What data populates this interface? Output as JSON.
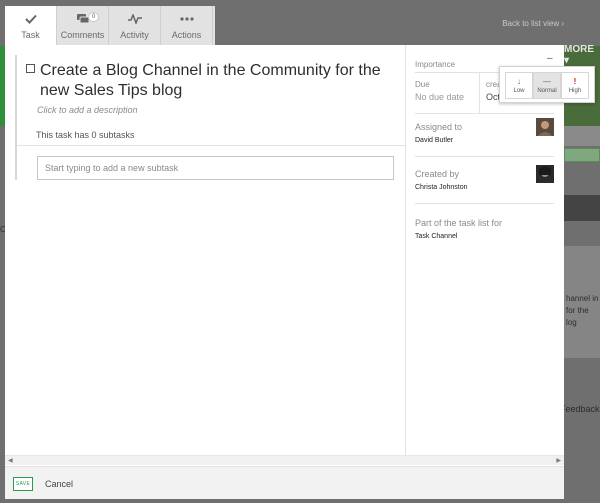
{
  "background": {
    "back_link": "Back to list view ›",
    "more_label": "MORE ▾",
    "side_text_lines": [
      "hannel in",
      "for the",
      "log"
    ],
    "feedback": "Feedback",
    "left_text": "Co"
  },
  "tabs": [
    {
      "label": "Task",
      "icon": "check-icon",
      "active": true
    },
    {
      "label": "Comments",
      "icon": "comments-icon",
      "badge": "0"
    },
    {
      "label": "Activity",
      "icon": "activity-icon"
    },
    {
      "label": "Actions",
      "icon": "more-icon"
    }
  ],
  "task": {
    "title": "Create a Blog Channel in the Community for the new Sales Tips blog",
    "description_placeholder": "Click to add a description",
    "subtasks_count_text": "This task has 0 subtasks",
    "new_subtask_placeholder": "Start typing to add a new subtask"
  },
  "sidebar": {
    "importance_label": "Importance",
    "importance_value": "–",
    "due_label": "Due",
    "due_value": "No due date",
    "created_label": "crea",
    "created_value": "Oct",
    "assigned_label": "Assigned to",
    "assigned_name": "David Butler",
    "created_by_label": "Created by",
    "created_by_name": "Christa Johnston",
    "task_list_label": "Part of the task list for",
    "task_list_name": "Task Channel"
  },
  "importance_popover": {
    "options": [
      {
        "label": "Low",
        "icon": "↓"
      },
      {
        "label": "Normal",
        "icon": "—",
        "selected": true
      },
      {
        "label": "High",
        "icon": "!"
      }
    ]
  },
  "footer": {
    "save_label": "SAVE",
    "cancel_label": "Cancel"
  },
  "colors": {
    "accent_green": "#2e9a46",
    "high_priority_red": "#dd1111"
  }
}
